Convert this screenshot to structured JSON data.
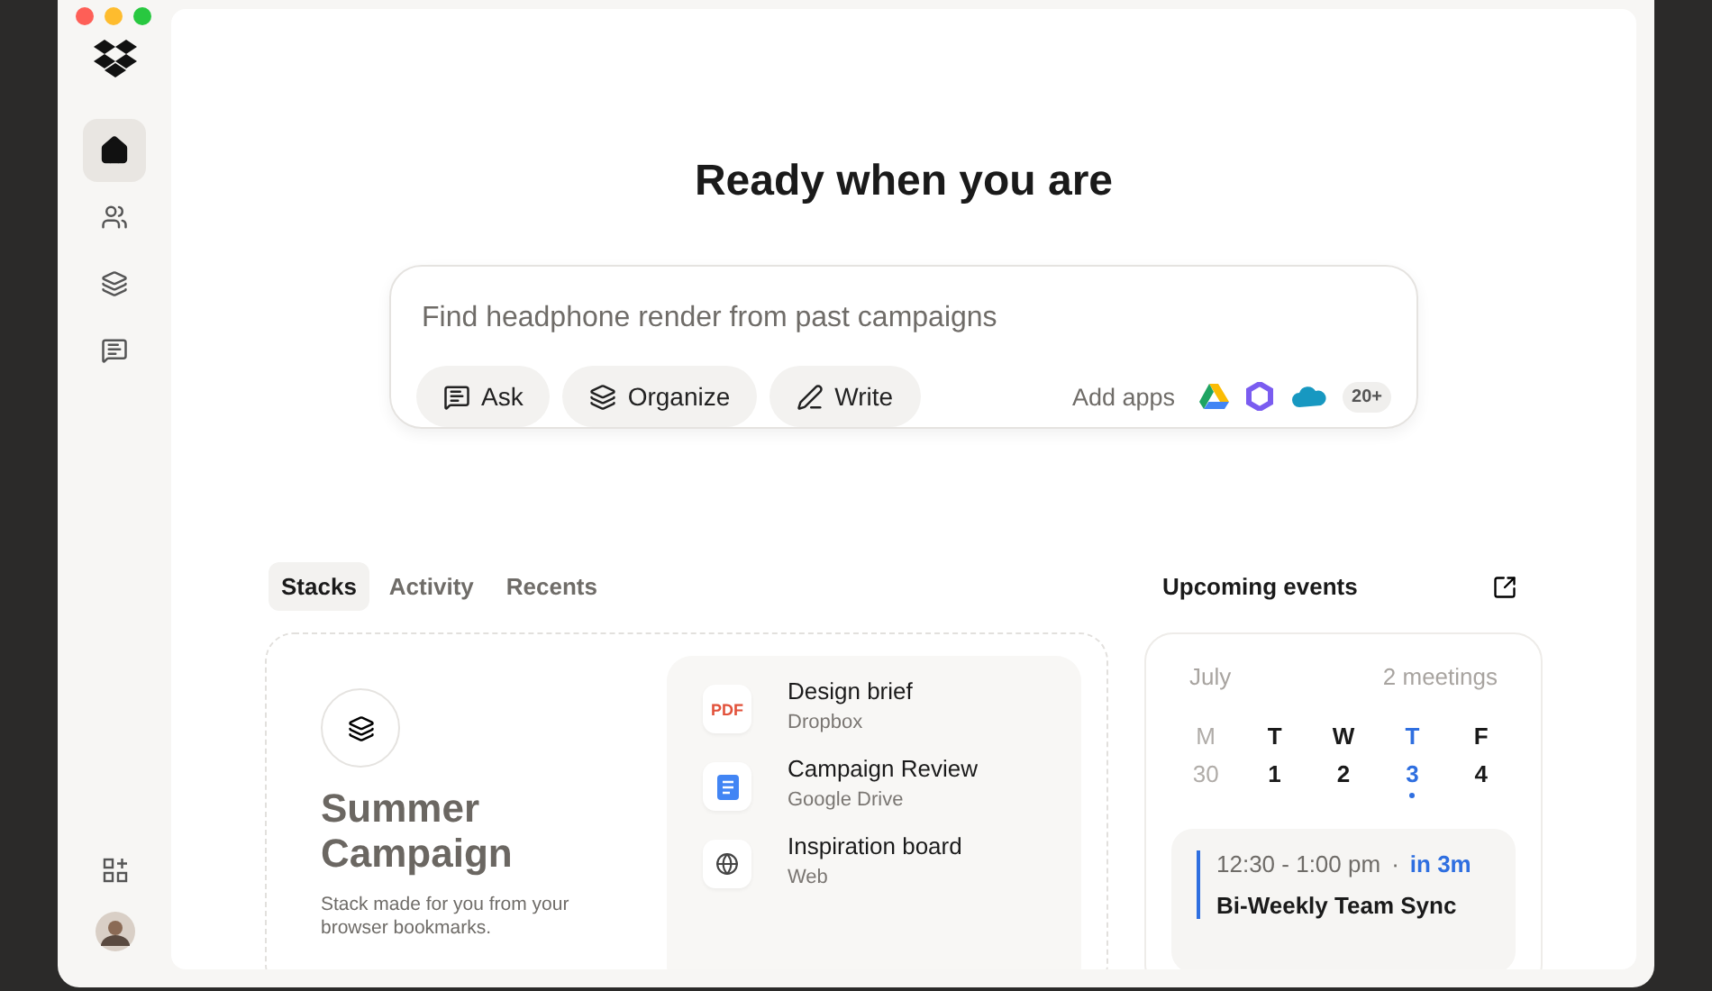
{
  "sidebar": {
    "items": [
      {
        "kind": "home",
        "selected": true
      },
      {
        "kind": "people",
        "selected": false
      },
      {
        "kind": "stacks",
        "selected": false
      },
      {
        "kind": "chat",
        "selected": false
      }
    ]
  },
  "heading": "Ready when you are",
  "search": {
    "placeholder": "Find headphone render from past campaigns",
    "actions": [
      {
        "kind": "ask",
        "label": "Ask"
      },
      {
        "kind": "organize",
        "label": "Organize"
      },
      {
        "kind": "write",
        "label": "Write"
      }
    ],
    "add_apps": "Add apps",
    "apps": [
      {
        "kind": "drive"
      },
      {
        "kind": "hexagon"
      },
      {
        "kind": "cloud"
      }
    ],
    "more_apps": "20+"
  },
  "tabs": [
    {
      "label": "Stacks",
      "selected": true
    },
    {
      "label": "Activity",
      "selected": false
    },
    {
      "label": "Recents",
      "selected": false
    }
  ],
  "stack": {
    "title": "Summer Campaign",
    "description": "Stack made for you from your browser bookmarks.",
    "items": [
      {
        "kind": "pdf",
        "badge": "PDF",
        "name": "Design brief",
        "source": "Dropbox"
      },
      {
        "kind": "doc",
        "name": "Campaign Review",
        "source": "Google Drive"
      },
      {
        "kind": "web",
        "name": "Inspiration board",
        "source": "Web"
      }
    ]
  },
  "events": {
    "title": "Upcoming events",
    "month": "July",
    "count": "2 meetings",
    "days": [
      {
        "weekday": "M",
        "date": "30",
        "past": true,
        "selected": false,
        "has_event": false
      },
      {
        "weekday": "T",
        "date": "1",
        "past": false,
        "selected": false,
        "has_event": false
      },
      {
        "weekday": "W",
        "date": "2",
        "past": false,
        "selected": false,
        "has_event": false
      },
      {
        "weekday": "T",
        "date": "3",
        "past": false,
        "selected": true,
        "has_event": true
      },
      {
        "weekday": "F",
        "date": "4",
        "past": false,
        "selected": false,
        "has_event": false
      }
    ],
    "event": {
      "time": "12:30 - 1:00 pm",
      "separator": "·",
      "starts_in": "in 3m",
      "title": "Bi-Weekly Team Sync"
    }
  }
}
